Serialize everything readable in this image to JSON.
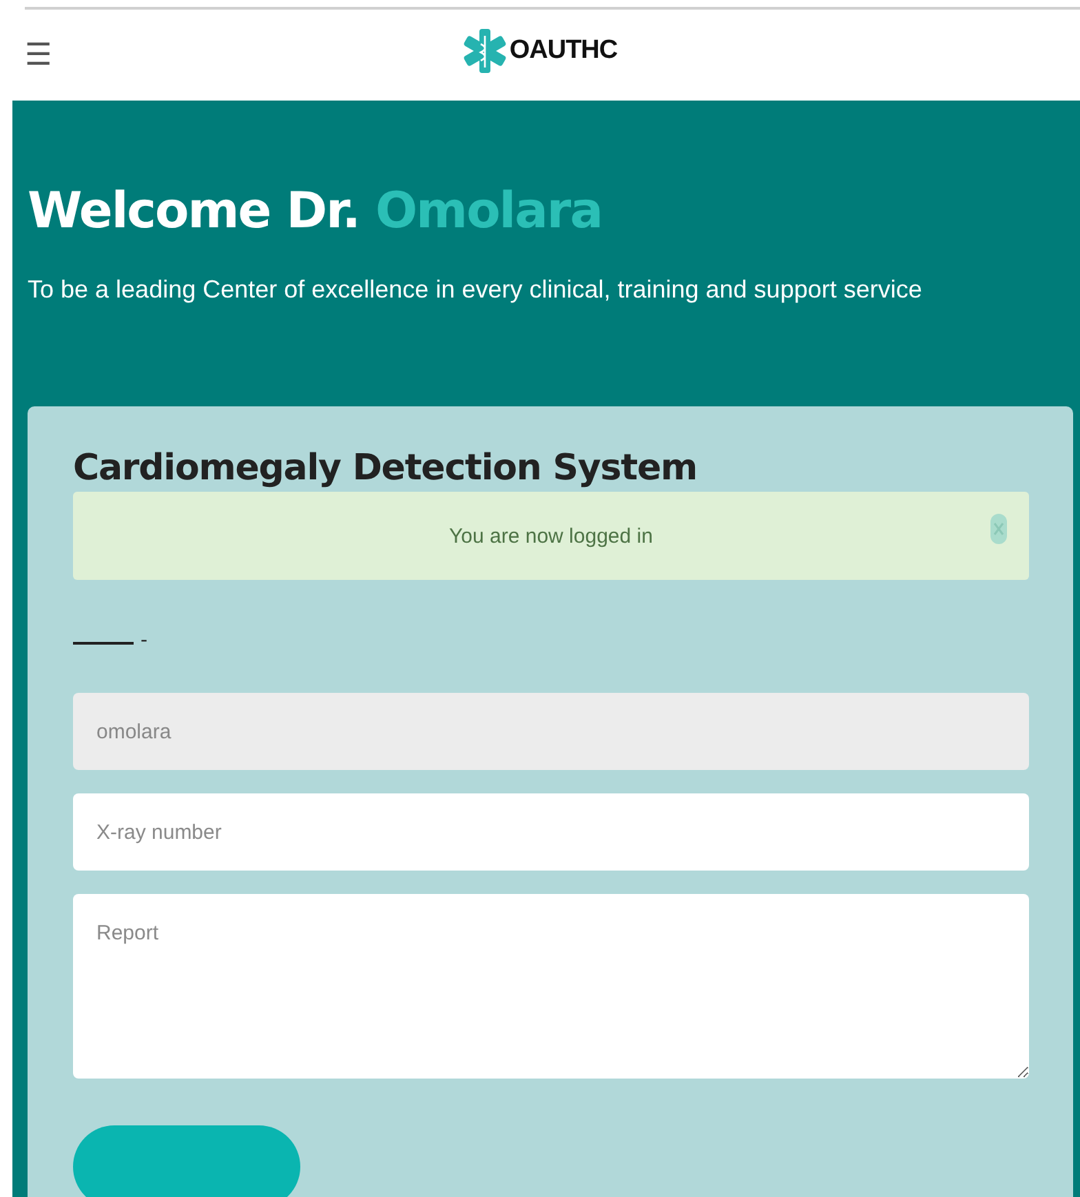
{
  "header": {
    "menu_icon": "☰",
    "logo_text": "OAUTHC"
  },
  "hero": {
    "greeting": "Welcome Dr.",
    "name": "Omolara",
    "tagline": "To be a leading Center of excellence in every clinical, training and support service"
  },
  "card": {
    "title": "Cardiomegaly Detection System",
    "alert": {
      "message": "You are now logged in"
    },
    "dash_text": "-",
    "fields": [
      {
        "kind": "input",
        "value": "omolara",
        "disabled": true
      },
      {
        "kind": "input",
        "placeholder": "X-ray number",
        "disabled": false
      },
      {
        "kind": "textarea",
        "placeholder": "Report",
        "disabled": false
      }
    ]
  }
}
